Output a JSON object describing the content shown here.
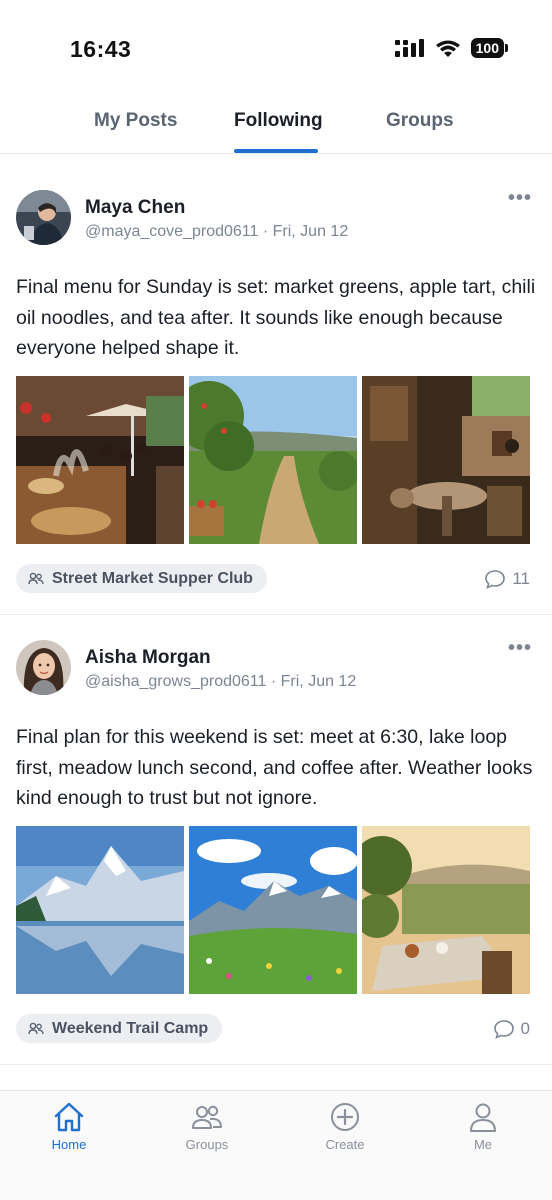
{
  "status": {
    "time": "16:43",
    "battery": "100"
  },
  "tabs": [
    {
      "label": "My Posts"
    },
    {
      "label": "Following"
    },
    {
      "label": "Groups"
    }
  ],
  "posts": [
    {
      "author": "Maya Chen",
      "handle": "@maya_cove_prod0611",
      "date": "Fri, Jun 12",
      "text": "Final menu for Sunday is set: market greens, apple tart, chili oil noodles, and tea after. It sounds like enough because everyone helped shape it.",
      "group": "Street Market Supper Club",
      "comments": "11"
    },
    {
      "author": "Aisha Morgan",
      "handle": "@aisha_grows_prod0611",
      "date": "Fri, Jun 12",
      "text": "Final plan for this weekend is set: meet at 6:30, lake loop first, meadow lunch second, and coffee after. Weather looks kind enough to trust but not ignore.",
      "group": "Weekend Trail Camp",
      "comments": "0"
    }
  ],
  "nav": [
    {
      "label": "Home",
      "icon": "home-icon",
      "active": true
    },
    {
      "label": "Groups",
      "icon": "groups-icon"
    },
    {
      "label": "Create",
      "icon": "plus-circle-icon"
    },
    {
      "label": "Me",
      "icon": "person-icon"
    }
  ],
  "colors": {
    "accent": "#1f6fd1",
    "muted": "#7d8593",
    "chip": "#eceef2"
  }
}
